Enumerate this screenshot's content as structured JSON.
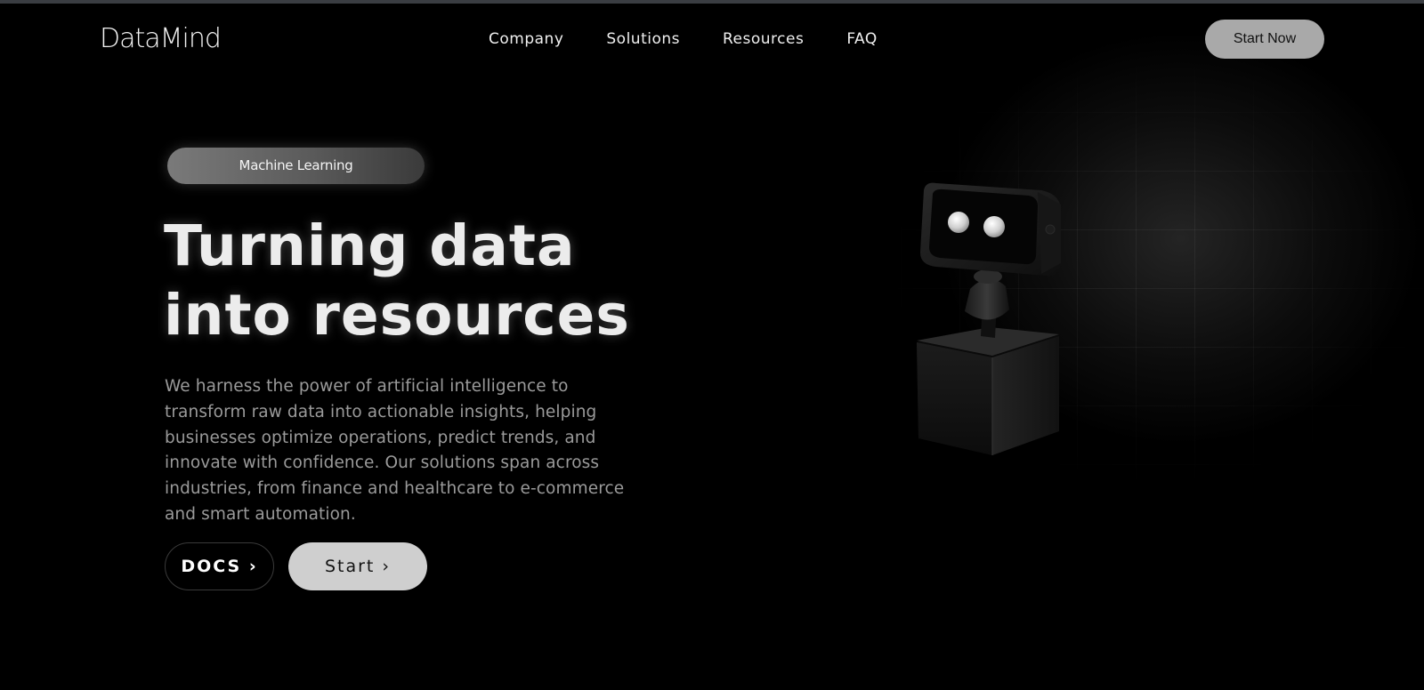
{
  "header": {
    "logo": "DataMind",
    "nav": [
      "Company",
      "Solutions",
      "Resources",
      "FAQ"
    ],
    "cta_label": "Start Now"
  },
  "hero": {
    "badge": "Machine Learning",
    "headline_line1": "Turning data",
    "headline_line2": "into resources",
    "description": "We harness the power of artificial intelligence to transform raw data into actionable insights, helping businesses optimize operations, predict trends, and innovate with confidence. Our solutions span across industries, from finance and healthcare to e-commerce and smart automation.",
    "docs_label": "DOCS ›",
    "start_label": "Start ›"
  },
  "illustration": {
    "icon": "robot-icon"
  },
  "colors": {
    "background": "#000000",
    "accent_button": "#a9a9a9",
    "primary_button": "#cfcfcf",
    "text_muted": "#9a9a9a"
  }
}
